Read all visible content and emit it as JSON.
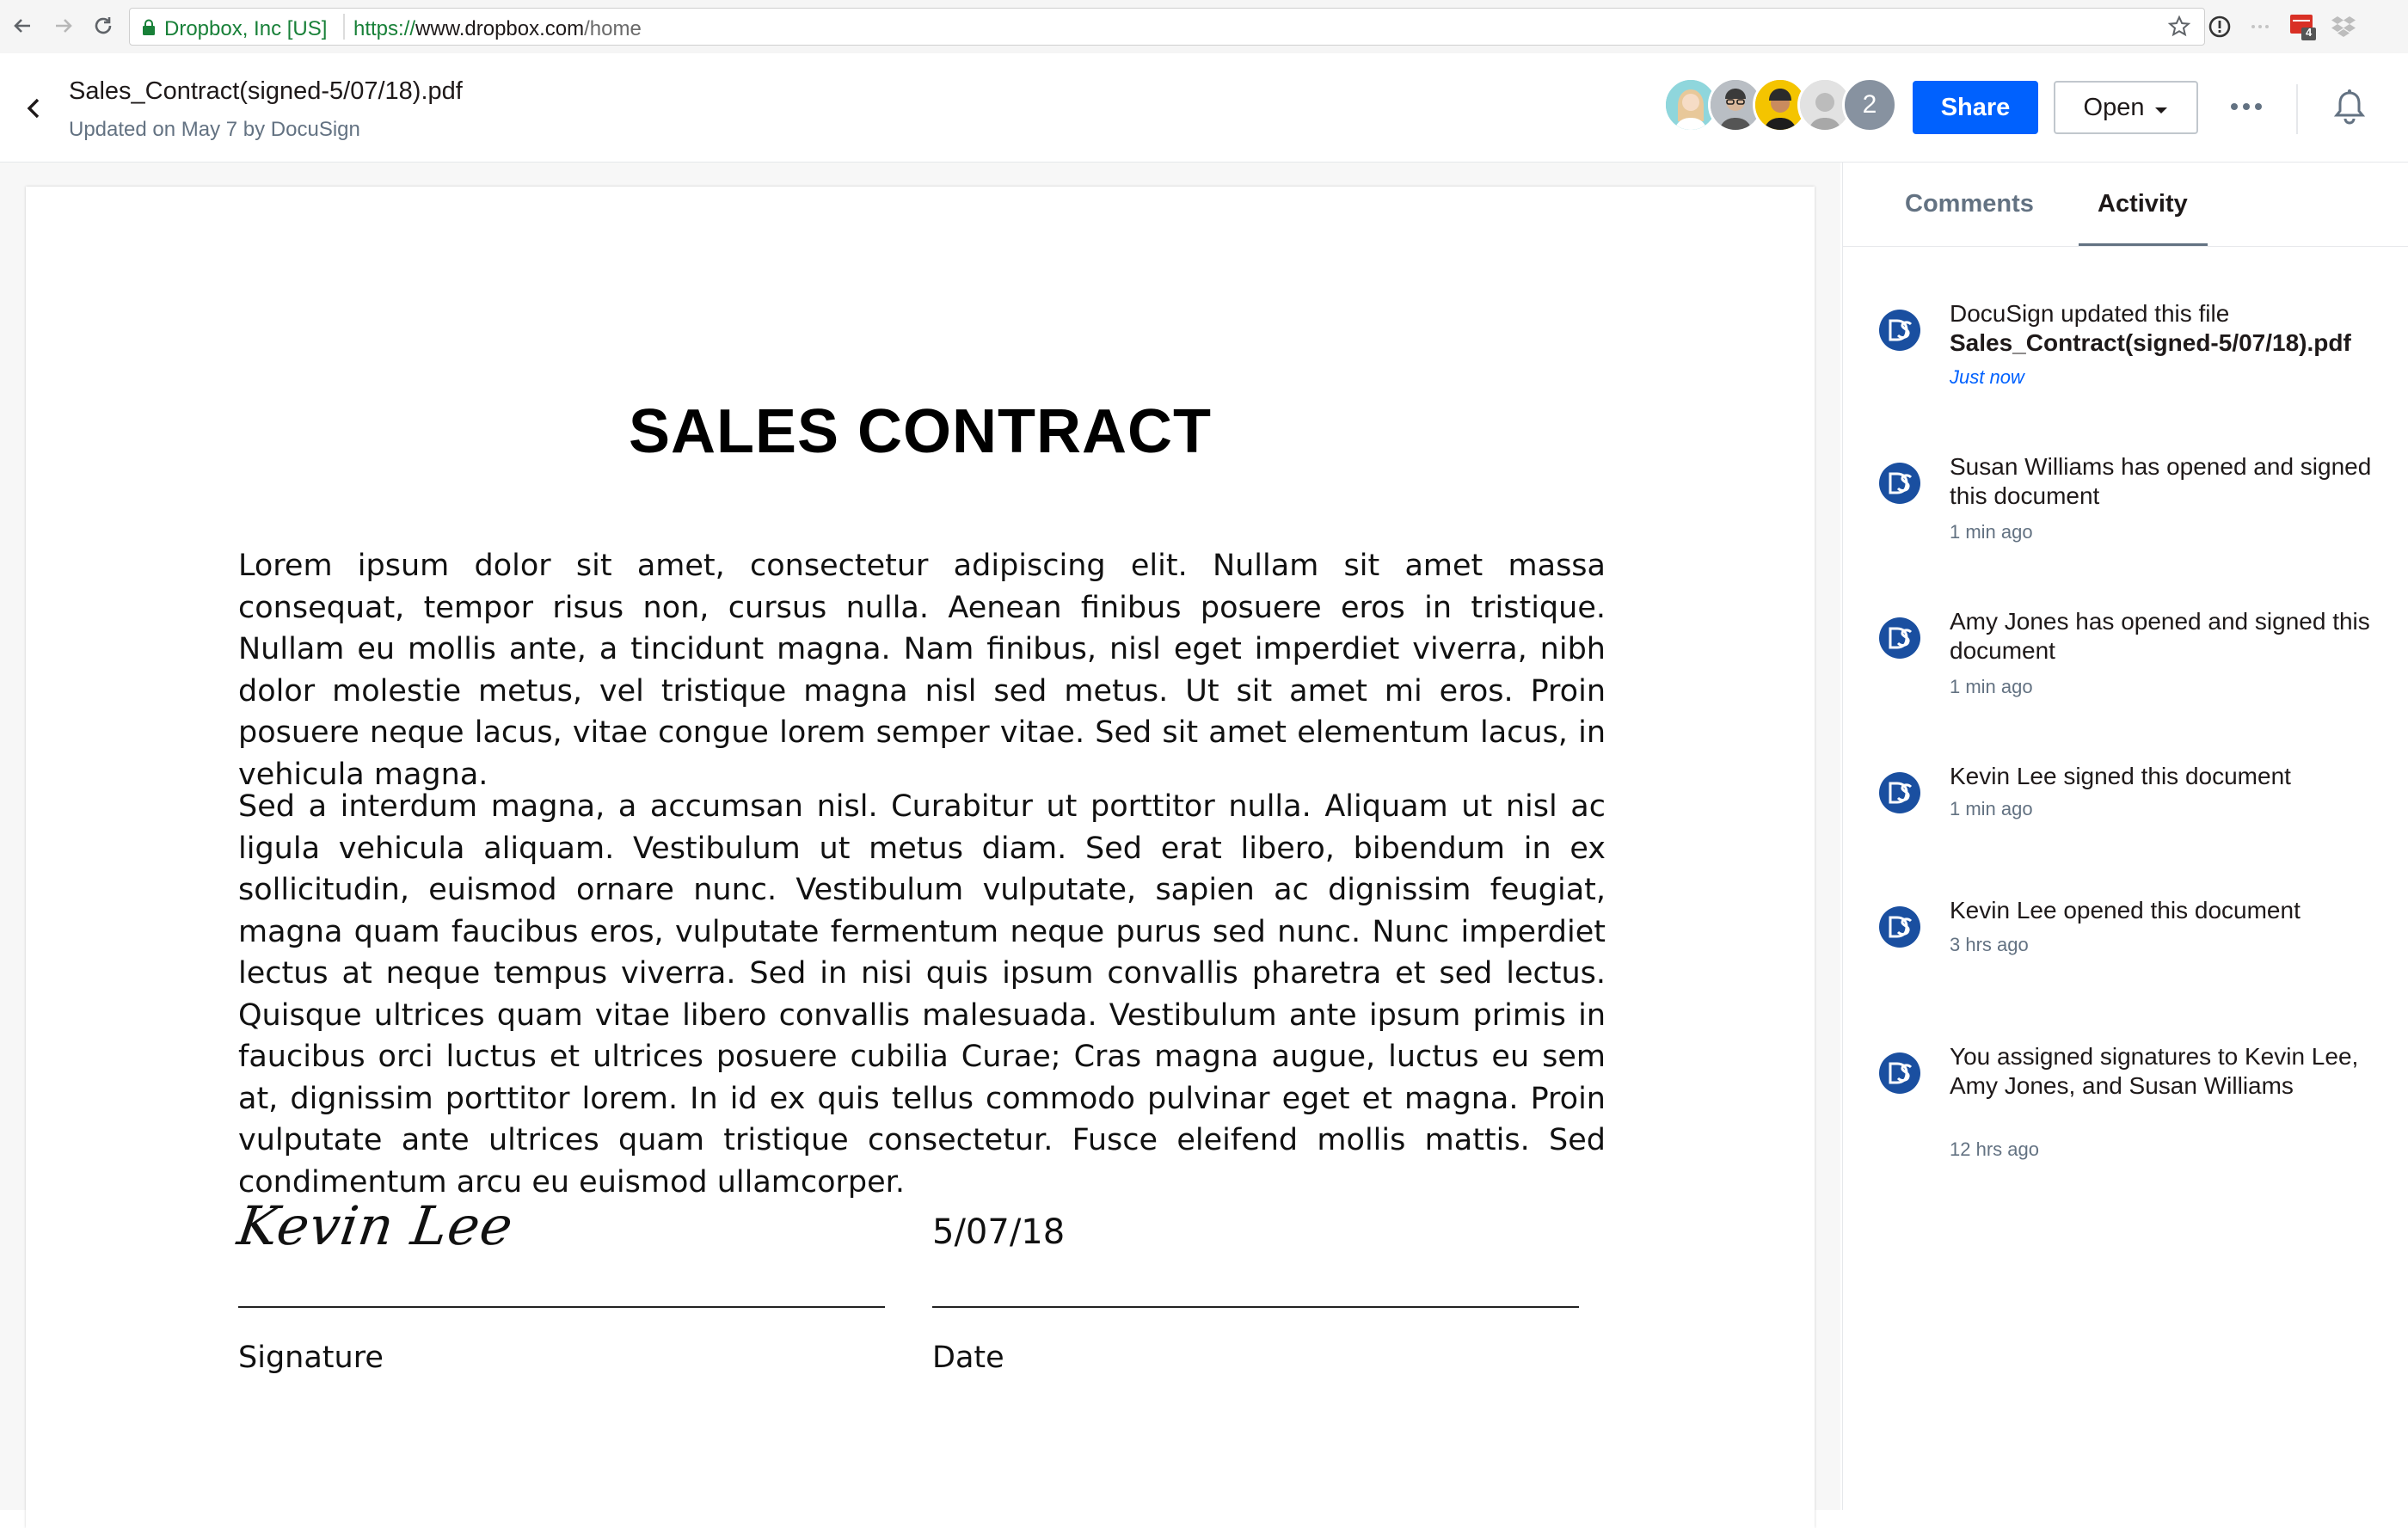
{
  "browser": {
    "secure_label": "Dropbox, Inc [US]",
    "url_scheme": "https://",
    "url_host": "www.dropbox.com",
    "url_path": "/home",
    "extension_badge": "4"
  },
  "header": {
    "file_name": "Sales_Contract(signed-5/07/18).pdf",
    "updated_text": "Updated on May 7 by DocuSign",
    "extra_collaborators": "2",
    "share_label": "Share",
    "open_label": "Open"
  },
  "document": {
    "title": "SALES CONTRACT",
    "paragraph1": "Lorem ipsum dolor sit amet, consectetur adipiscing elit. Nullam sit amet massa consequat, tempor risus non, cursus nulla. Aenean finibus posuere eros in tristique. Nullam eu mollis ante, a tincidunt magna. Nam finibus, nisl eget imperdiet viverra, nibh dolor molestie metus, vel tristique magna nisl sed metus. Ut sit amet mi eros. Proin posuere neque lacus, vitae congue lorem semper vitae. Sed sit amet elementum lacus, in vehicula magna.",
    "paragraph2": "Sed a interdum magna, a accumsan nisl. Curabitur ut porttitor nulla. Aliquam ut nisl ac ligula vehicula aliquam. Vestibulum ut metus diam. Sed erat libero, bibendum in ex sollicitudin, euismod ornare nunc. Vestibulum vulputate, sapien ac dignissim feugiat, magna quam faucibus eros, vulputate fermentum neque purus sed nunc. Nunc imperdiet lectus at neque tempus viverra. Sed in nisi quis ipsum convallis pharetra et sed lectus. Quisque ultrices quam vitae libero convallis malesuada. Vestibulum ante ipsum primis in faucibus orci luctus et ultrices posuere cubilia Curae; Cras magna augue, luctus eu sem at, dignissim porttitor lorem. In id ex quis tellus commodo pulvinar eget et magna. Proin vulputate ante ultrices quam tristique consectetur. Fusce eleifend mollis mattis. Sed condimentum arcu eu euismod ullamcorper.",
    "signature_name": "Kevin Lee",
    "date_value": "5/07/18",
    "signature_label": "Signature",
    "date_label": "Date"
  },
  "panel": {
    "tabs": [
      {
        "label": "Comments"
      },
      {
        "label": "Activity"
      }
    ],
    "activity": [
      {
        "text": "DocuSign updated this file",
        "file": "Sales_Contract(signed-5/07/18).pdf",
        "time": "Just now"
      },
      {
        "text": "Susan Williams has opened and signed this document",
        "time": "1 min ago"
      },
      {
        "text": "Amy Jones has opened and signed this document",
        "time": "1 min ago"
      },
      {
        "text": "Kevin Lee signed this document",
        "time": "1 min ago"
      },
      {
        "text": "Kevin Lee opened this document",
        "time": "3 hrs ago"
      },
      {
        "text": "You assigned signatures to Kevin Lee, Amy Jones, and Susan Williams",
        "time": "12 hrs ago"
      }
    ]
  },
  "colors": {
    "accent_blue": "#0061fe",
    "docusign_blue": "#1a4fa0",
    "secure_green": "#188038",
    "muted_text": "#637282"
  },
  "icons": [
    "back-arrow-icon",
    "forward-arrow-icon",
    "reload-icon",
    "lock-icon",
    "star-icon",
    "info-icon",
    "extension-icon",
    "calendar-extension-icon",
    "dropbox-extension-icon",
    "chevron-left-icon",
    "chevron-down-icon",
    "more-icon",
    "bell-icon",
    "docusign-icon"
  ]
}
